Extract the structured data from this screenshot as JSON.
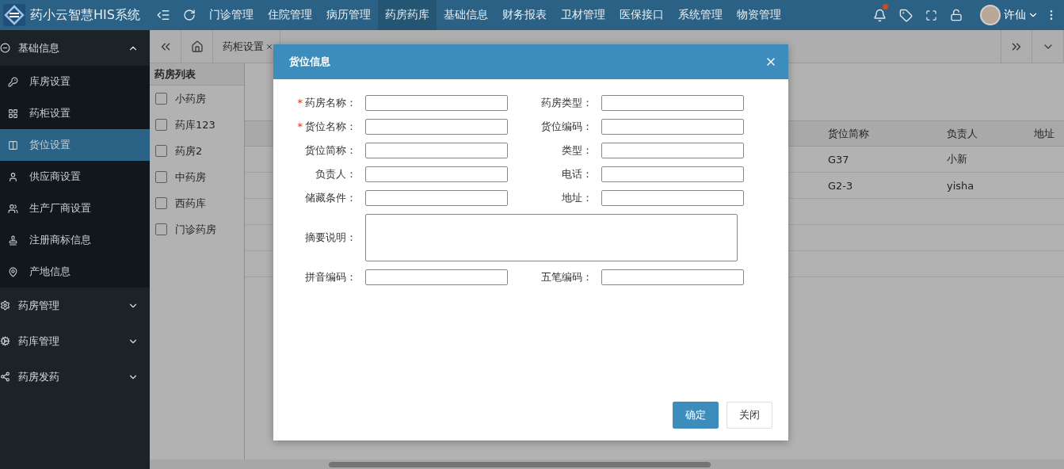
{
  "app": {
    "title": "药小云智慧HIS系统"
  },
  "nav": [
    {
      "label": "门诊管理",
      "selected": false
    },
    {
      "label": "住院管理",
      "selected": false
    },
    {
      "label": "病历管理",
      "selected": false
    },
    {
      "label": "药房药库",
      "selected": true
    },
    {
      "label": "基础信息",
      "selected": false
    },
    {
      "label": "财务报表",
      "selected": false
    },
    {
      "label": "卫材管理",
      "selected": false
    },
    {
      "label": "医保接口",
      "selected": false
    },
    {
      "label": "系统管理",
      "selected": false
    },
    {
      "label": "物资管理",
      "selected": false
    }
  ],
  "user": {
    "name": "许仙",
    "has_notification": true
  },
  "sidebar": [
    {
      "label": "基础信息",
      "expanded": true,
      "children": [
        {
          "label": "库房设置",
          "selected": false
        },
        {
          "label": "药柜设置",
          "selected": false
        },
        {
          "label": "货位设置",
          "selected": true
        },
        {
          "label": "供应商设置",
          "selected": false
        },
        {
          "label": "生产厂商设置",
          "selected": false
        },
        {
          "label": "注册商标信息",
          "selected": false
        },
        {
          "label": "产地信息",
          "selected": false
        }
      ]
    },
    {
      "label": "药房管理",
      "expanded": false
    },
    {
      "label": "药库管理",
      "expanded": false
    },
    {
      "label": "药房发药",
      "expanded": false
    }
  ],
  "page_tabs": [
    {
      "label": "药柜设置"
    }
  ],
  "pharmacy_list": {
    "title": "药房列表",
    "items": [
      {
        "label": "小药房",
        "checked": false
      },
      {
        "label": "药库123",
        "checked": false
      },
      {
        "label": "药房2",
        "checked": false
      },
      {
        "label": "中药房",
        "checked": false
      },
      {
        "label": "西药库",
        "checked": false
      },
      {
        "label": "门诊药房",
        "checked": false
      }
    ]
  },
  "table": {
    "columns": [
      "货位简称",
      "负责人",
      "地址"
    ],
    "rows": [
      [
        "G37",
        "小新",
        ""
      ],
      [
        "G2-3",
        "yisha",
        ""
      ]
    ]
  },
  "dialog": {
    "title": "货位信息",
    "rows": [
      [
        {
          "label": "药房名称：",
          "required_mark": "*",
          "kind": "input"
        },
        {
          "label": "药房类型：",
          "kind": "input"
        }
      ],
      [
        {
          "label": "货位名称：",
          "required_mark": "*",
          "kind": "input"
        },
        {
          "label": "货位编码：",
          "kind": "input"
        }
      ],
      [
        {
          "label": "货位简称：",
          "kind": "input"
        },
        {
          "label": "类型：",
          "kind": "input"
        }
      ],
      [
        {
          "label": "负责人：",
          "kind": "input"
        },
        {
          "label": "电话：",
          "kind": "input"
        }
      ],
      [
        {
          "label": "储藏条件：",
          "kind": "input"
        },
        {
          "label": "地址：",
          "kind": "input"
        }
      ],
      [
        {
          "label": "摘要说明：",
          "kind": "textarea"
        }
      ],
      [
        {
          "label": "拼音编码：",
          "kind": "input"
        },
        {
          "label": "五笔编码：",
          "kind": "input"
        }
      ]
    ],
    "buttons": [
      {
        "label": "确定",
        "kind": "primary"
      },
      {
        "label": "关闭",
        "kind": "default"
      }
    ]
  }
}
